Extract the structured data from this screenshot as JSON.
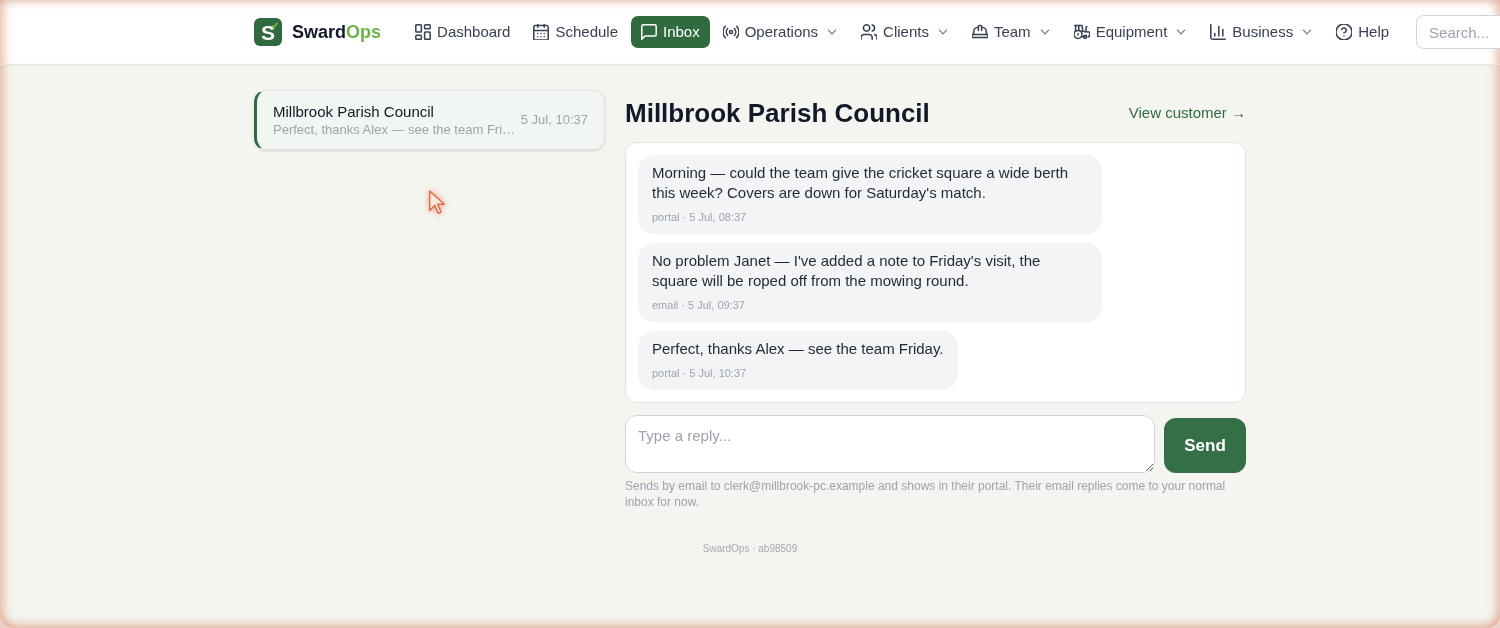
{
  "nav": {
    "brand": {
      "letter": "S",
      "name": "Sward",
      "accent": "Ops"
    },
    "items": [
      {
        "label": "Dashboard",
        "selected": false,
        "has_menu": false
      },
      {
        "label": "Schedule",
        "selected": false,
        "has_menu": false
      },
      {
        "label": "Inbox",
        "selected": true,
        "has_menu": false
      },
      {
        "label": "Operations",
        "selected": false,
        "has_menu": true
      },
      {
        "label": "Clients",
        "selected": false,
        "has_menu": true
      },
      {
        "label": "Team",
        "selected": false,
        "has_menu": true
      },
      {
        "label": "Equipment",
        "selected": false,
        "has_menu": true
      },
      {
        "label": "Business",
        "selected": false,
        "has_menu": true
      },
      {
        "label": "Help",
        "selected": false,
        "has_menu": false
      }
    ],
    "search": {
      "placeholder": "Search..."
    }
  },
  "conversations": [
    {
      "name": "Millbrook Parish Council",
      "preview": "Perfect, thanks Alex — see the team Fri…",
      "time": "5 Jul, 10:37",
      "selected": true
    }
  ],
  "thread": {
    "title": "Millbrook Parish Council",
    "link": "View customer →",
    "messages": [
      {
        "text": "Morning — could the team give the cricket square a wide berth this week? Covers are down for Saturday's match.",
        "meta": "portal · 5 Jul, 08:37"
      },
      {
        "text": "No problem Janet — I've added a note to Friday's visit, the square will be roped off from the mowing round.",
        "meta": "email · 5 Jul, 09:37"
      },
      {
        "text": "Perfect, thanks Alex — see the team Friday.",
        "meta": "portal · 5 Jul, 10:37"
      }
    ]
  },
  "reply": {
    "placeholder": "Type a reply...",
    "button": "Send",
    "note": "Sends by email to clerk@millbrook-pc.example and shows in their portal. Their email replies come to your normal inbox for now."
  },
  "footer": "SwardOps · ab98509"
}
